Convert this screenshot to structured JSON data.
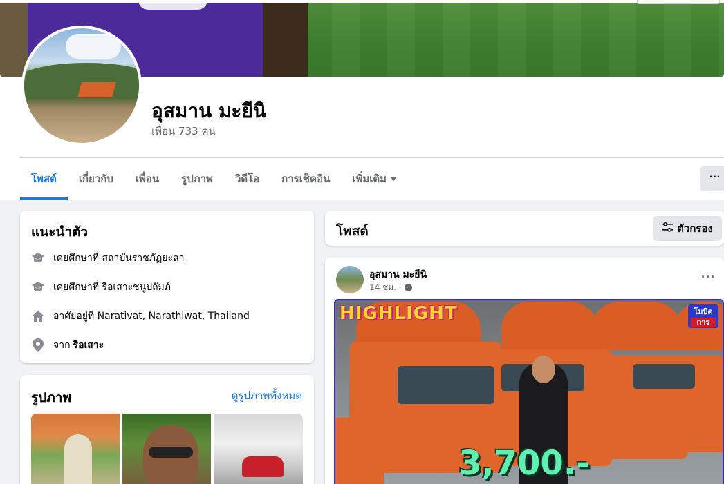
{
  "profile": {
    "name": "อุสมาน มะยีนิ",
    "friends": "เพื่อน 733 คน"
  },
  "tabs": [
    {
      "label": "โพสต์",
      "active": true
    },
    {
      "label": "เกี่ยวกับ"
    },
    {
      "label": "เพื่อน"
    },
    {
      "label": "รูปภาพ"
    },
    {
      "label": "วิดีโอ"
    },
    {
      "label": "การเช็คอิน"
    },
    {
      "label": "เพิ่มเติม"
    }
  ],
  "more_button": "···",
  "intro": {
    "title": "แนะนำตัว",
    "items": [
      {
        "icon": "graduation-cap-icon",
        "text": "เคยศึกษาที่ สถาบันราชภัฏยะลา"
      },
      {
        "icon": "graduation-cap-icon",
        "text": "เคยศึกษาที่ รือเสาะชนูปถัมภ์"
      },
      {
        "icon": "home-icon",
        "text": "อาศัยอยู่ที่ Narativat, Narathiwat, Thailand"
      },
      {
        "icon": "location-pin-icon",
        "prefix": "จาก",
        "bold": "รือเสาะ"
      }
    ]
  },
  "photos": {
    "title": "รูปภาพ",
    "see_all": "ดูรูปภาพทั้งหมด"
  },
  "posts_section": {
    "title": "โพสต์",
    "filter_label": "ตัวกรอง"
  },
  "post": {
    "author": "อุสมาน มะยีนิ",
    "time": "14 ชม. ·",
    "menu": "···",
    "image_text": {
      "highlight": "HIGHLIGHT",
      "price": "3,700.-",
      "badge_top": "โมบิด",
      "badge_bottom": "การ"
    }
  },
  "colors": {
    "accent": "#1877f2",
    "background": "#f0f2f5",
    "secondary_text": "#65676b"
  }
}
